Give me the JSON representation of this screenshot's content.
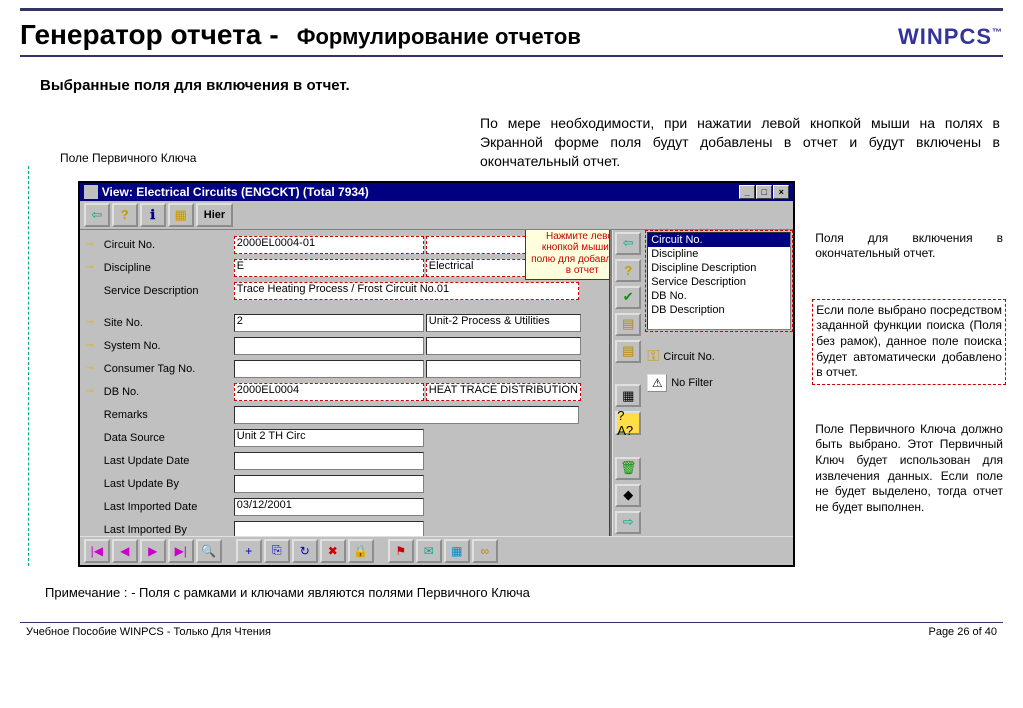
{
  "header": {
    "title_main": "Генератор отчета",
    "separator": "-",
    "title_sub": "Формулирование отчетов",
    "logo": "WINPCS",
    "logo_tm": "™"
  },
  "section_title": "Выбранные поля для включения в отчет.",
  "left_label": "Поле Первичного Ключа",
  "intro_text": "По мере необходимости, при нажатии левой кнопкой мыши на полях в Экранной форме поля будут добавлены в отчет и будут включены в окончательный отчет.",
  "window": {
    "title": "View: Electrical Circuits (ENGCKT) (Total 7934)",
    "hier_btn": "Hier",
    "tooltip": "Нажмите левой кнопкой мыши по полю для добавления в отчет",
    "fields": [
      {
        "key": true,
        "label": "Circuit No.",
        "value": "2000EL0004-01",
        "value2": "",
        "dash": true
      },
      {
        "key": true,
        "label": "Discipline",
        "value": "E",
        "value2": "Electrical",
        "dash": true
      },
      {
        "key": false,
        "label": "Service Description",
        "value": "Trace Heating Process / Frost Circuit No.01",
        "dash": true,
        "wide": true
      },
      {
        "key": true,
        "label": "Site No.",
        "value": "2",
        "value2": "Unit-2 Process & Utilities"
      },
      {
        "key": true,
        "label": "System No.",
        "value": "",
        "value2": ""
      },
      {
        "key": true,
        "label": "Consumer Tag No.",
        "value": "",
        "value2": ""
      },
      {
        "key": true,
        "label": "DB No.",
        "value": "2000EL0004",
        "value2": "HEAT TRACE DISTRIBUTION BOAR",
        "dash": true
      },
      {
        "key": false,
        "label": "Remarks",
        "value": "",
        "wide": true
      },
      {
        "key": false,
        "label": "Data Source",
        "value": "Unit 2 TH Circ"
      },
      {
        "key": false,
        "label": "Last Update Date",
        "value": ""
      },
      {
        "key": false,
        "label": "Last Update By",
        "value": ""
      },
      {
        "key": false,
        "label": "Last Imported Date",
        "value": "03/12/2001"
      },
      {
        "key": false,
        "label": "Last Imported By",
        "value": ""
      }
    ],
    "selected_fields": [
      "Circuit No.",
      "Discipline",
      "Discipline Description",
      "Service Description",
      "DB No.",
      "DB Description"
    ],
    "primary_key_field": "Circuit No.",
    "filter_text": "No Filter"
  },
  "right_notes": {
    "note1": "Поля для включения в окончательный отчет.",
    "note2": "Если поле выбрано посредством заданной функции поиска (Поля без рамок), данное поле поиска будет автоматически добавлено в отчет.",
    "note3": "Поле Первичного Ключа должно быть выбрано. Этот Первичный Ключ будет использован для извлечения данных. Если поле не будет выделено, тогда отчет не будет выполнен."
  },
  "footnote": "Примечание : - Поля с рамками и ключами являются полями Первичного Ключа",
  "footer": {
    "left": "Учебное Пособие WINPCS - Только Для Чтения",
    "right": "Page 26 of 40"
  }
}
